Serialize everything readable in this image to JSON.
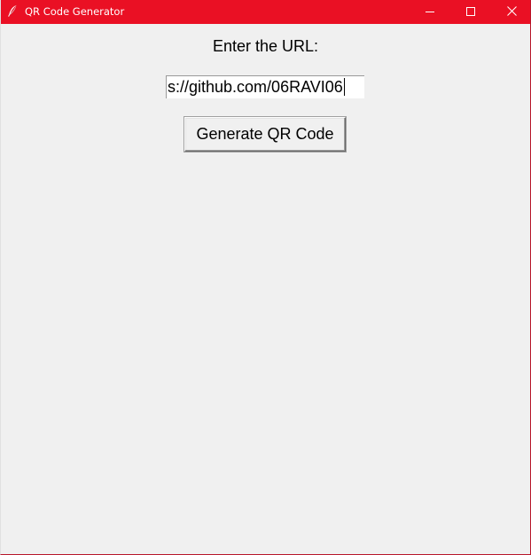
{
  "window": {
    "title": "QR Code Generator",
    "titlebar_color": "#ea1024",
    "icons": {
      "app": "feather-icon",
      "minimize": "minimize-icon",
      "maximize": "maximize-icon",
      "close": "close-icon"
    }
  },
  "form": {
    "prompt_label": "Enter the URL:",
    "url_value": "s://github.com/06RAVI06",
    "generate_label": "Generate QR Code"
  }
}
